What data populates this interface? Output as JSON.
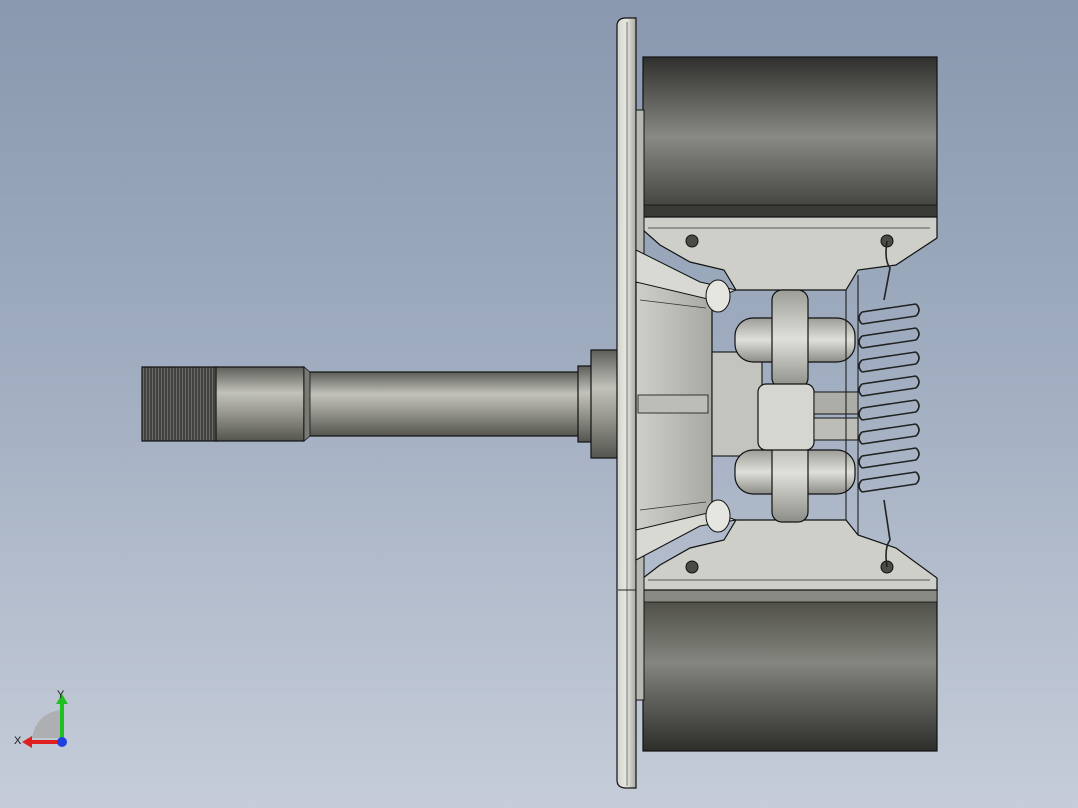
{
  "viewport": {
    "background_top": "#8998ae",
    "background_bottom": "#c6cdd9"
  },
  "part": {
    "body_color": "#5a5a55",
    "metal_color": "#c9c9c3",
    "edge_color": "#111111"
  },
  "triad": {
    "x_label": "X",
    "y_label": "Y",
    "x_color": "#e02020",
    "y_color": "#20c020",
    "z_color": "#2040e0"
  }
}
